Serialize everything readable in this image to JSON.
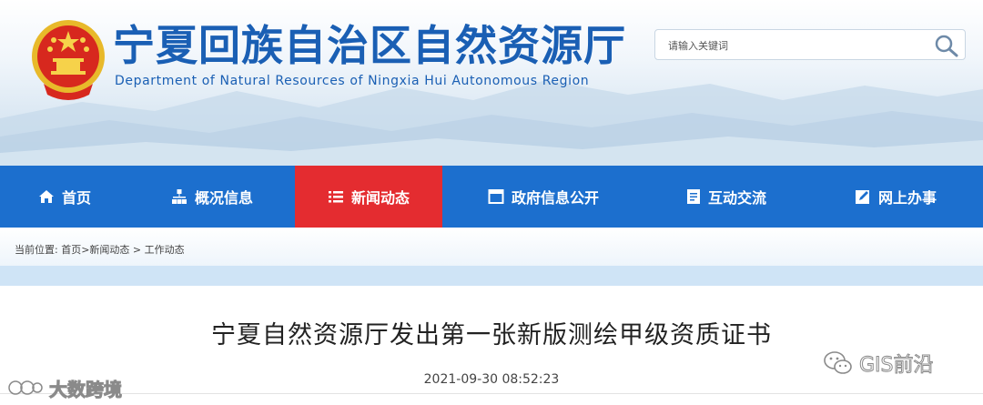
{
  "header": {
    "title_cn": "宁夏回族自治区自然资源厅",
    "title_en": "Department of Natural Resources of Ningxia Hui Autonomous Region",
    "emblem_icon": "national-emblem-icon"
  },
  "search": {
    "placeholder": "请输入关键词",
    "icon": "search-icon"
  },
  "nav": {
    "items": [
      {
        "label": "首页",
        "icon": "home-icon"
      },
      {
        "label": "概况信息",
        "icon": "org-chart-icon"
      },
      {
        "label": "新闻动态",
        "icon": "list-icon",
        "active": true
      },
      {
        "label": "政府信息公开",
        "icon": "window-icon"
      },
      {
        "label": "互动交流",
        "icon": "document-icon"
      },
      {
        "label": "网上办事",
        "icon": "edit-icon"
      }
    ]
  },
  "breadcrumb": {
    "prefix": "当前位置:",
    "path": "首页>新闻动态 > 工作动态"
  },
  "article": {
    "title": "宁夏自然资源厅发出第一张新版测绘甲级资质证书",
    "date": "2021-09-30 08:52:23"
  },
  "watermarks": {
    "left": "大数跨境",
    "right": "GIS前沿"
  },
  "colors": {
    "nav_bg": "#1c6fce",
    "nav_active": "#e42c30",
    "title_blue": "#1a5fb4"
  }
}
